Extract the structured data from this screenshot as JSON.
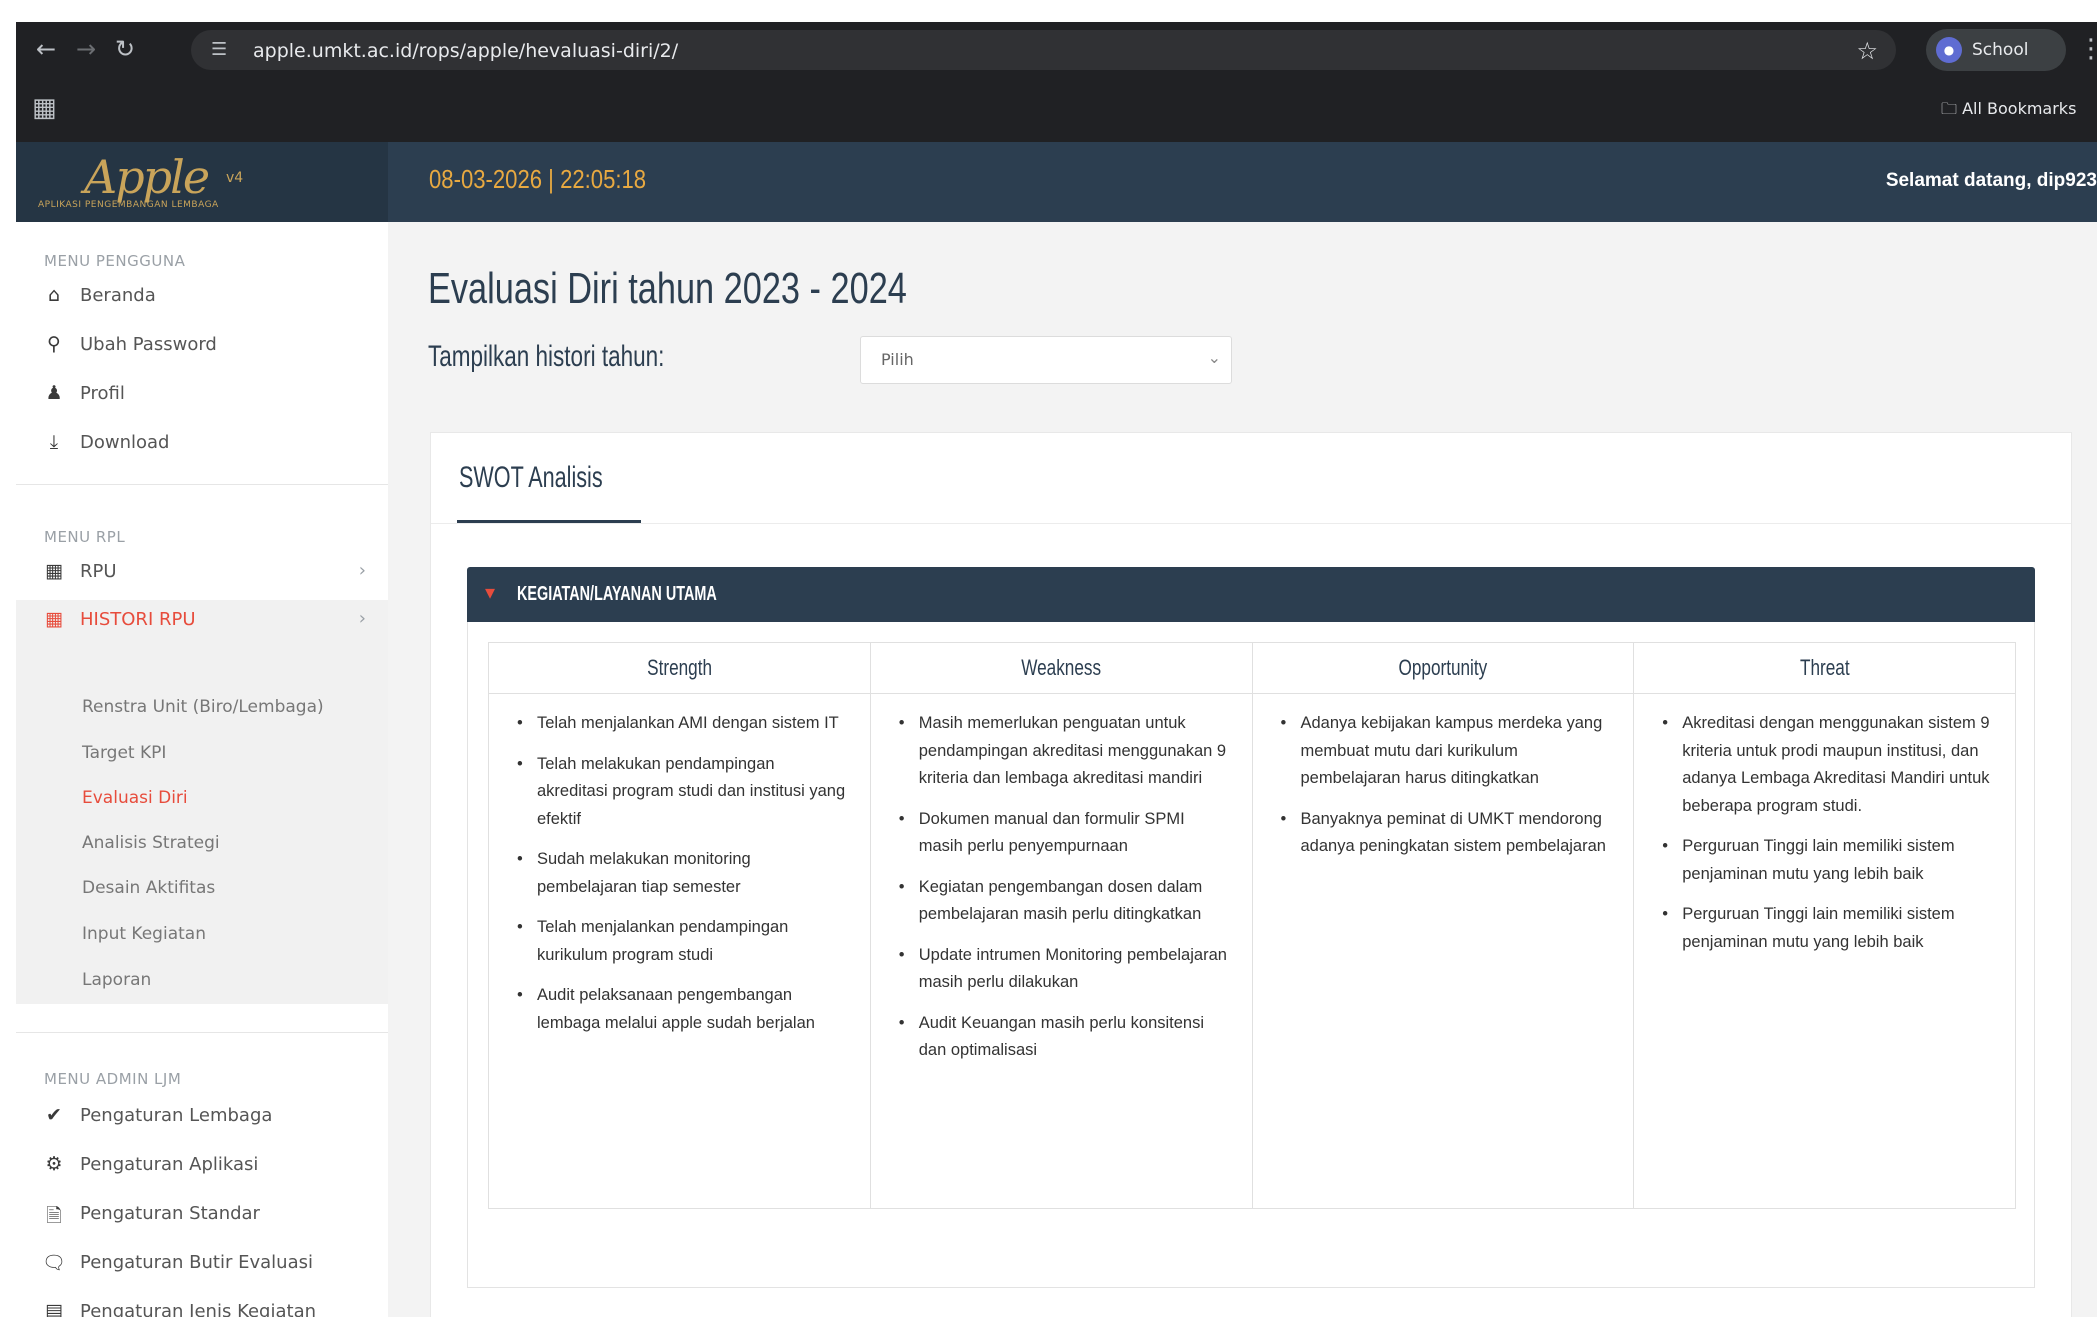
{
  "browser": {
    "url": "apple.umkt.ac.id/rops/apple/hevaluasi-diri/2/",
    "profile_label": "School",
    "bookmarks_label": "All Bookmarks"
  },
  "header": {
    "brand": "Apple",
    "brand_version": "v4",
    "brand_subtitle": "APLIKASI PENGEMBANGAN LEMBAGA",
    "datetime": "08-03-2026 | 22:05:18",
    "welcome": "Selamat datang, dip923"
  },
  "sidebar": {
    "menu_pengguna": {
      "heading": "MENU PENGGUNA",
      "items": [
        {
          "label": "Beranda",
          "icon": "home-icon"
        },
        {
          "label": "Ubah Password",
          "icon": "key-icon"
        },
        {
          "label": "Profil",
          "icon": "user-icon"
        },
        {
          "label": "Download",
          "icon": "download-icon"
        }
      ]
    },
    "menu_rpl": {
      "heading": "MENU RPL",
      "items": [
        {
          "label": "RPU",
          "icon": "calendar-icon"
        },
        {
          "label": "HISTORI RPU",
          "icon": "calendar-icon"
        }
      ],
      "submenu": [
        "Renstra Unit (Biro/Lembaga)",
        "Target KPI",
        "Evaluasi Diri",
        "Analisis Strategi",
        "Desain Aktifitas",
        "Input Kegiatan",
        "Laporan"
      ]
    },
    "menu_admin": {
      "heading": "MENU ADMIN LJM",
      "items": [
        {
          "label": "Pengaturan Lembaga",
          "icon": "check-icon"
        },
        {
          "label": "Pengaturan Aplikasi",
          "icon": "cogs-icon"
        },
        {
          "label": "Pengaturan Standar",
          "icon": "file-icon"
        },
        {
          "label": "Pengaturan Butir Evaluasi",
          "icon": "comment-icon"
        },
        {
          "label": "Pengaturan Jenis Kegiatan",
          "icon": "list-icon"
        }
      ]
    }
  },
  "main": {
    "title": "Evaluasi Diri tahun 2023 - 2024",
    "history_label": "Tampilkan histori tahun:",
    "history_select": "Pilih",
    "card_title": "SWOT Analisis",
    "accordion_title": "KEGIATAN/LAYANAN UTAMA",
    "swot": {
      "headers": [
        "Strength",
        "Weakness",
        "Opportunity",
        "Threat"
      ],
      "strength": [
        "Telah menjalankan AMI dengan sistem IT",
        "Telah melakukan pendampingan akreditasi program studi dan institusi yang efektif",
        "Sudah melakukan monitoring pembelajaran tiap semester",
        "Telah menjalankan pendampingan kurikulum program studi",
        "Audit pelaksanaan pengembangan lembaga melalui apple sudah berjalan"
      ],
      "weakness": [
        "Masih memerlukan penguatan untuk pendampingan akreditasi menggunakan 9 kriteria dan lembaga akreditasi mandiri",
        "Dokumen manual dan formulir SPMI masih perlu penyempurnaan",
        "Kegiatan pengembangan dosen dalam pembelajaran masih perlu ditingkatkan",
        "Update intrumen Monitoring pembelajaran masih perlu dilakukan",
        "Audit Keuangan masih perlu konsitensi dan optimalisasi"
      ],
      "opportunity": [
        "Adanya kebijakan kampus merdeka yang membuat mutu dari kurikulum pembelajaran harus ditingkatkan",
        "Banyaknya peminat di UMKT mendorong adanya peningkatan sistem pembelajaran"
      ],
      "threat": [
        "Akreditasi dengan menggunakan sistem 9 kriteria untuk prodi maupun institusi, dan adanya Lembaga Akreditasi Mandiri untuk beberapa program studi.",
        "Perguruan Tinggi lain memiliki sistem penjaminan mutu yang lebih baik",
        "Perguruan Tinggi lain memiliki sistem penjaminan mutu yang lebih baik"
      ]
    }
  }
}
